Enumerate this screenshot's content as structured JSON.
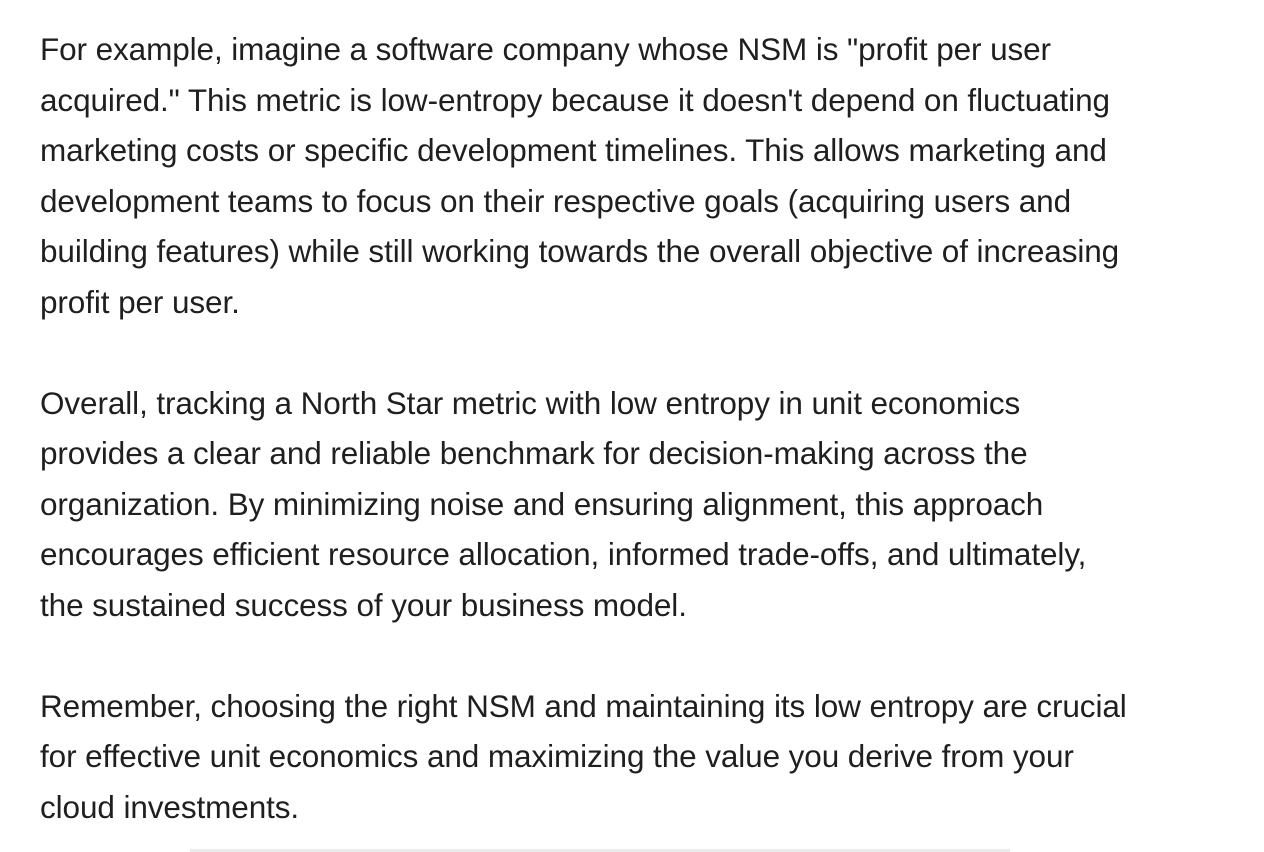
{
  "paragraphs": [
    {
      "lines": [
        "For example, imagine a software company whose NSM is \"profit per user",
        "acquired.\" This metric is low-entropy because it doesn't depend on fluctuating",
        "marketing costs or specific development timelines. This allows marketing and",
        "development teams to focus on their respective goals (acquiring users and",
        "building features) while still working towards the overall objective of increasing",
        "profit per user."
      ]
    },
    {
      "lines": [
        "Overall, tracking a North Star metric with low entropy in unit economics",
        "provides a clear and reliable benchmark for decision-making across the",
        "organization. By minimizing noise and ensuring alignment, this approach",
        "encourages efficient resource allocation, informed trade-offs, and ultimately,",
        "the sustained success of your business model."
      ]
    },
    {
      "lines": [
        "Remember, choosing the right NSM and maintaining its low entropy are crucial",
        "for effective unit economics and maximizing the value you derive from your",
        "cloud investments."
      ]
    }
  ]
}
